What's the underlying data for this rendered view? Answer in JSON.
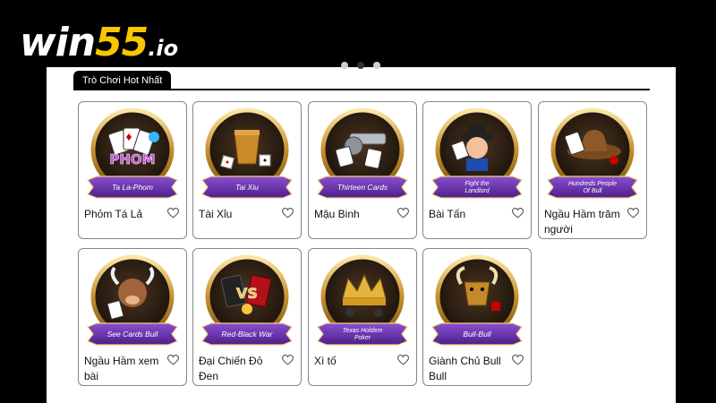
{
  "brand": {
    "logo_main": "win",
    "logo_num": "55",
    "logo_domain": ".io"
  },
  "section": {
    "tab_label": "Trò Chơi Hot Nhất"
  },
  "carousel": {
    "dot_count": 3,
    "active_index": 1
  },
  "games": [
    {
      "name": "Phỏm Tá Lả",
      "banner": "Ta La-Phom",
      "title_art": "PHOM",
      "icon": "playing-cards-icon"
    },
    {
      "name": "Tài Xỉu",
      "banner": "Tai Xiu",
      "icon": "dice-cup-icon"
    },
    {
      "name": "Mậu Binh",
      "banner": "Thirteen Cards",
      "icon": "revolver-cards-icon"
    },
    {
      "name": "Bài Tấn",
      "banner": "Fight the Landlord",
      "icon": "landlord-character-icon"
    },
    {
      "name": "Ngầu Hầm trăm người",
      "banner": "Hundreds People Of Bull",
      "icon": "cowboy-hat-icon"
    },
    {
      "name": "Ngầu Hầm xem bài",
      "banner": "See Cards Bull",
      "icon": "bull-character-icon"
    },
    {
      "name": "Đại Chiến Đỏ Đen",
      "banner": "Red-Black War",
      "title_art": "VS",
      "icon": "red-black-cards-icon"
    },
    {
      "name": "Xì tố",
      "banner": "Texas Holdem Poker",
      "icon": "crown-chips-icon"
    },
    {
      "name": "Giành Chủ Bull Bull",
      "banner": "Bull-Bull",
      "icon": "bull-head-icon"
    }
  ]
}
